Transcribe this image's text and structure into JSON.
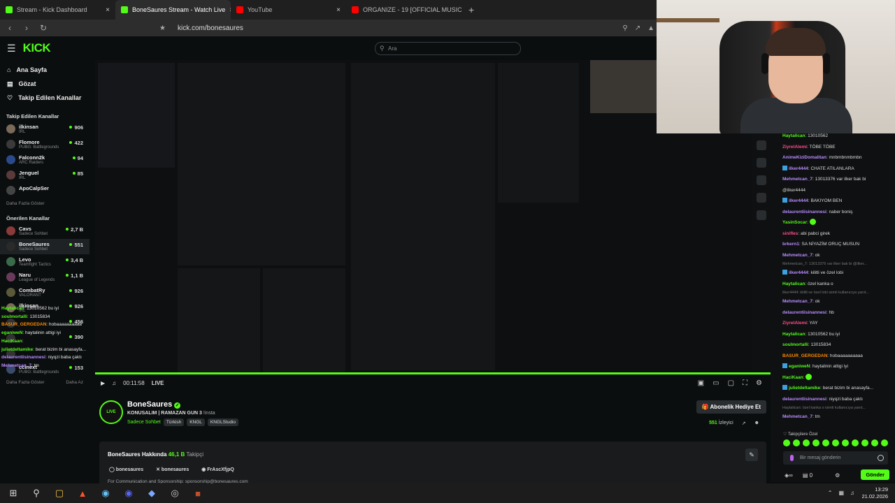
{
  "browser": {
    "tabs": [
      {
        "label": "Stream - Kick Dashboard",
        "color": "#53fc18"
      },
      {
        "label": "BoneSaures Stream - Watch Live",
        "color": "#53fc18"
      },
      {
        "label": "YouTube",
        "color": "#ff0000"
      },
      {
        "label": "ORGANIZE - 19 [OFFICIAL MUSIC",
        "color": "#ff0000"
      }
    ],
    "url": "kick.com/bonesaures"
  },
  "topnav": {
    "logo": "KICK",
    "search_placeholder": "Ara"
  },
  "sidebar": {
    "nav": [
      "Ana Sayfa",
      "Gözat",
      "Takip Edilen Kanallar"
    ],
    "followed_header": "Takip Edilen Kanallar",
    "followed": [
      {
        "name": "ilkinsan",
        "game": "IRL",
        "viewers": "906",
        "color": "#7a6a5a"
      },
      {
        "name": "Flomore",
        "game": "PUBG: Battlegrounds",
        "viewers": "422",
        "color": "#3a3a3a"
      },
      {
        "name": "Falconn2k",
        "game": "ARC Raiders",
        "viewers": "94",
        "color": "#2a4a8a"
      },
      {
        "name": "Jenguel",
        "game": "IRL",
        "viewers": "85",
        "color": "#5a3a3a"
      },
      {
        "name": "ApoCalpSer",
        "game": "",
        "viewers": "",
        "color": "#444"
      }
    ],
    "followed_more": "Daha Fazla Göster",
    "recommended_header": "Önerilen Kanallar",
    "recommended": [
      {
        "name": "Cavs",
        "game": "Sadece Sohbet",
        "viewers": "2,7 B",
        "color": "#8a3a3a"
      },
      {
        "name": "BoneSaures",
        "game": "Sadece Sohbet",
        "viewers": "551",
        "color": "#2a2a2a"
      },
      {
        "name": "Levo",
        "game": "Teamfight Tactics",
        "viewers": "3,4 B",
        "color": "#3a6a4a"
      },
      {
        "name": "Naru",
        "game": "League of Legends",
        "viewers": "1,1 B",
        "color": "#6a3a5a"
      },
      {
        "name": "CombatRy",
        "game": "VALORANT",
        "viewers": "926",
        "color": "#5a5a3a"
      },
      {
        "name": "ilkinsan",
        "game": "IRL",
        "viewers": "926",
        "color": "#7a6a5a"
      },
      {
        "name": "",
        "game": "",
        "viewers": "456",
        "color": "#333"
      },
      {
        "name": "",
        "game": "",
        "viewers": "390",
        "color": "#333"
      },
      {
        "name": "",
        "game": "",
        "viewers": "",
        "color": "#333"
      },
      {
        "name": "ccinext",
        "game": "PUBG: Battlegrounds",
        "viewers": "153",
        "color": "#3a4a6a"
      }
    ],
    "rec_more": "Daha Fazla Göster",
    "rec_less": "Daha Az"
  },
  "overlay_chat": [
    {
      "user": "Haytalican",
      "text": "13010562 bu iyi",
      "color": "#53fc18"
    },
    {
      "user": "soulmortalli",
      "text": "13015834",
      "color": "#53fc18"
    },
    {
      "user": "BASUR_GERGEDAN",
      "text": "hobaaaaaaaaaa",
      "color": "#ff8a00"
    },
    {
      "user": "eganiweN",
      "text": "haytalinin attigi iyi",
      "color": "#53fc18"
    },
    {
      "user": "HaciKaan",
      "text": "",
      "color": "#53fc18"
    },
    {
      "user": "julietdeltamike",
      "text": "berat bizim bi anasayfa...",
      "color": "#53fc18"
    },
    {
      "user": "delaurentiisinannesi",
      "text": "niyqzi baba çaktı",
      "color": "#b98cff"
    },
    {
      "user": "Mehmetcan_7",
      "text": "tm",
      "color": "#b98cff"
    }
  ],
  "player": {
    "time": "00:11:58",
    "live": "LIVE",
    "progress": 1.0
  },
  "channel": {
    "name": "BoneSaures",
    "title": "KONUSALIM | RAMAZAN GUN 3",
    "title_suffix": "!insta",
    "category": "Sadece Sohbet",
    "tags": [
      "Türkish",
      "KNGL",
      "KNGLStudio"
    ],
    "gift_button": "Abonelik Hediye Et",
    "viewers": "551",
    "viewers_label": "İzleyici"
  },
  "about": {
    "title": "BoneSaures Hakkında",
    "followers": "46,1 B",
    "followers_label": "Takipçi",
    "instagram": "bonesaures",
    "x": "bonesaures",
    "discord": "FrAscXfjpQ",
    "sponsor_text": "For Communication and Sponsorship: sponsorship@bonesaures.com"
  },
  "chat": {
    "messages": [
      {
        "user": "Haytalican",
        "text": "13010562",
        "color": "#53fc18",
        "badge": false
      },
      {
        "user": "ZiyrelAlemi",
        "text": "TÖBE TÖBE",
        "color": "#ff4d8a",
        "badge": false
      },
      {
        "user": "AnimeKiziDomalitan",
        "text": "mnbmbnmbmbn",
        "color": "#b98cff",
        "badge": false
      },
      {
        "user": "ilker4444",
        "text": "CHATE ATILANLARA",
        "color": "#b98cff",
        "badge": true
      },
      {
        "user": "Mehmetcan_7",
        "text": "13013376 var ilker bak bi",
        "color": "#b98cff",
        "badge": false
      },
      {
        "user": "",
        "text": "@ilker4444",
        "color": "#ddd",
        "badge": false
      },
      {
        "user": "ilker4444",
        "text": "BAKIYOM BEN",
        "color": "#b98cff",
        "badge": true
      },
      {
        "user": "delaurentiisinannesi",
        "text": "naber boniş",
        "color": "#b98cff",
        "badge": false
      },
      {
        "user": "YasinSocar",
        "text": "",
        "color": "#53fc18",
        "badge": false,
        "emote": true
      },
      {
        "user": "sinifles",
        "text": "abi pabci girek",
        "color": "#ff4d8a",
        "badge": false
      },
      {
        "user": "brkern1",
        "text": "SA NİYAZİM ORUÇ MUSUN",
        "color": "#b98cff",
        "badge": false
      },
      {
        "user": "Mehmetcan_7",
        "text": "ok",
        "color": "#b98cff",
        "badge": false
      },
      {
        "user": "",
        "text": "Mehmetcan_7: 13013376 var ilker bak bi @ilker...",
        "color": "#777",
        "badge": false,
        "reply": true
      },
      {
        "user": "ilker4444",
        "text": "kilitli ve özel lobi",
        "color": "#b98cff",
        "badge": true
      },
      {
        "user": "Haytalican",
        "text": "özel kanka o",
        "color": "#53fc18",
        "badge": false
      },
      {
        "user": "",
        "text": "ilker4444: kilitli ve özel lobi isimli kullanıcıya yanıt...",
        "color": "#777",
        "badge": false,
        "reply": true
      },
      {
        "user": "Mehmetcan_7",
        "text": "ok",
        "color": "#b98cff",
        "badge": false
      },
      {
        "user": "delaurentiisinannesi",
        "text": "hb",
        "color": "#b98cff",
        "badge": false
      },
      {
        "user": "ZiyrelAlemi",
        "text": "YAY",
        "color": "#ff4d8a",
        "badge": false
      },
      {
        "user": "Haytalican",
        "text": "13010562 bu iyi",
        "color": "#53fc18",
        "badge": false
      },
      {
        "user": "soulmortalli",
        "text": "13015834",
        "color": "#53fc18",
        "badge": false
      },
      {
        "user": "BASUR_GERGEDAN",
        "text": "hobaaaaaaaaaa",
        "color": "#ff8a00",
        "badge": false
      },
      {
        "user": "eganiweN",
        "text": "haytalinin attigi iyi",
        "color": "#53fc18",
        "badge": true
      },
      {
        "user": "HaciKaan",
        "text": "",
        "color": "#53fc18",
        "badge": false,
        "emote": true
      },
      {
        "user": "julietdeltamike",
        "text": "berat bizim bi anasayfa...",
        "color": "#53fc18",
        "badge": true
      },
      {
        "user": "delaurentiisinannesi",
        "text": "niyqzi baba çaktı",
        "color": "#b98cff",
        "badge": false
      },
      {
        "user": "",
        "text": "Haytalican: özel kanka o isimli kullanıcıya yanıt...",
        "color": "#777",
        "badge": false,
        "reply": true
      },
      {
        "user": "Mehmetcan_7",
        "text": "tm",
        "color": "#b98cff",
        "badge": false
      }
    ],
    "followers_only_label": "Takipçilere Özel",
    "input_placeholder": "Bir mesaj gönderin",
    "points": "0",
    "send_label": "Gönder"
  },
  "taskbar": {
    "time": "13:29",
    "date": "21.02.2026"
  }
}
